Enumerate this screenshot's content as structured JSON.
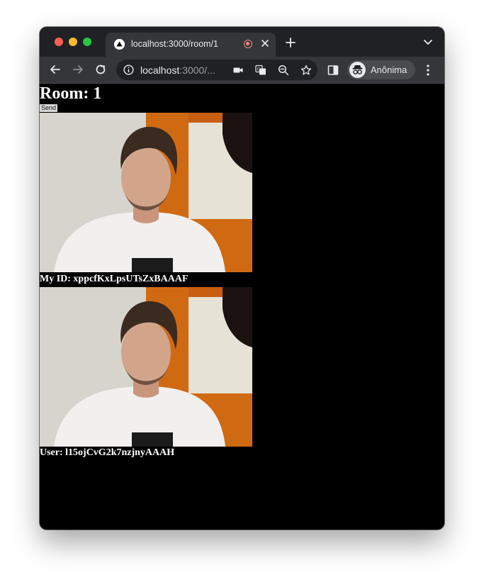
{
  "browser": {
    "tab_title": "localhost:3000/room/1",
    "url_host": "localhost",
    "url_rest": ":3000/...",
    "profile_label": "Anônima"
  },
  "page": {
    "room_title": "Room: 1",
    "send_label": "Send",
    "my_id_label": "My ID: xppcfKxLpsUTsZxBAAAF",
    "remote_user_label": "User: l15ojCvG2k7nzjnyAAAH"
  },
  "icons": {
    "favicon": "triangle-logo-icon",
    "recording": "recording-indicator-icon",
    "camera": "camera-icon",
    "translate": "translate-icon",
    "zoom": "zoom-out-icon",
    "bookmark": "star-icon",
    "incognito": "incognito-icon"
  },
  "colors": {
    "chrome_dark": "#202124",
    "toolbar": "#35363a",
    "page_background": "#000000",
    "text": "#ffffff"
  }
}
